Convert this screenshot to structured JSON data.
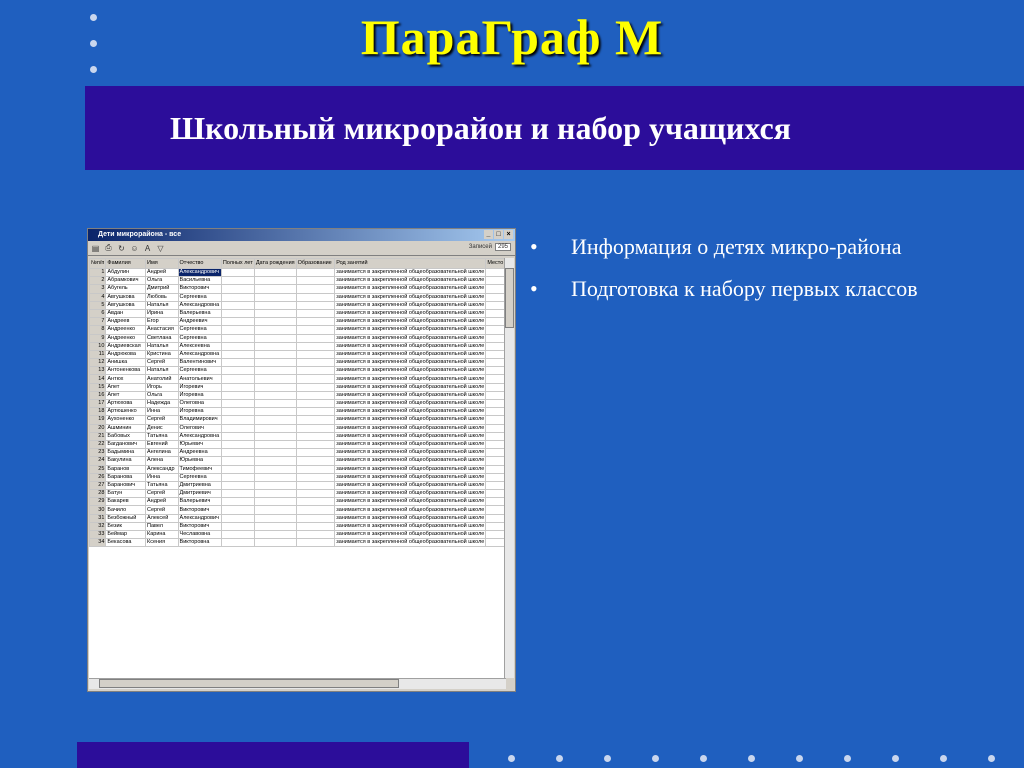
{
  "slide": {
    "title": "ПараГраф М",
    "subtitle": "Школьный микрорайон и набор учащихся",
    "bullets": [
      "Информация о детях микро-района",
      "Подготовка к набору первых классов"
    ]
  },
  "window": {
    "title": "Дети микрорайона - все",
    "controls": [
      "_",
      "□",
      "×"
    ],
    "toolbar_icons": [
      "save-icon",
      "print-icon",
      "refresh-icon",
      "person-icon",
      "text-icon",
      "filter-icon"
    ],
    "toolbar_glyphs": [
      "▤",
      "⎙",
      "↻",
      "☺",
      "A",
      "▽"
    ],
    "status_label": "Записей",
    "status_count": "295",
    "columns": [
      "№п/п",
      "Фамилия",
      "Имя",
      "Отчество",
      "Полных лет",
      "Дата рождения",
      "Образование",
      "Род занятий",
      "Место"
    ],
    "occupation": "занимается в закрепленной общеобразовательной школе",
    "rows": [
      [
        "1",
        "Абдулин",
        "Андрей",
        "Александрович"
      ],
      [
        "2",
        "Абрамкович",
        "Ольга",
        "Васильевна"
      ],
      [
        "3",
        "Абугель",
        "Дмитрий",
        "Викторович"
      ],
      [
        "4",
        "Авгушкова",
        "Любовь",
        "Сергеевна"
      ],
      [
        "5",
        "Авгушкова",
        "Наталья",
        "Александровна"
      ],
      [
        "6",
        "Авдан",
        "Ирина",
        "Валерьевна"
      ],
      [
        "7",
        "Андреев",
        "Егор",
        "Андреевич"
      ],
      [
        "8",
        "Андреенко",
        "Анастасия",
        "Сергеевна"
      ],
      [
        "9",
        "Андреенко",
        "Светлана",
        "Сергеевна"
      ],
      [
        "10",
        "Андриевская",
        "Наталья",
        "Алексеевна"
      ],
      [
        "11",
        "Андрюкова",
        "Кристина",
        "Александровна"
      ],
      [
        "12",
        "Анишка",
        "Сергей",
        "Валентинович"
      ],
      [
        "13",
        "Антоненкова",
        "Наталья",
        "Сергеевна"
      ],
      [
        "14",
        "Антюх",
        "Анатолий",
        "Анатольевич"
      ],
      [
        "15",
        "Апет",
        "Игорь",
        "Игоревич"
      ],
      [
        "16",
        "Апет",
        "Ольга",
        "Игоревна"
      ],
      [
        "17",
        "Артюхова",
        "Надежда",
        "Олеговна"
      ],
      [
        "18",
        "Артюшенко",
        "Инна",
        "Игоревна"
      ],
      [
        "19",
        "Аухоненко",
        "Сергей",
        "Владимирович"
      ],
      [
        "20",
        "Ашминин",
        "Денис",
        "Олегович"
      ],
      [
        "21",
        "Бабовых",
        "Татьяна",
        "Александровна"
      ],
      [
        "22",
        "Багданович",
        "Евгений",
        "Юрьевич"
      ],
      [
        "23",
        "Бадымина",
        "Ангелина",
        "Андреевна"
      ],
      [
        "24",
        "Бакулина",
        "Алена",
        "Юрьевна"
      ],
      [
        "25",
        "Баранов",
        "Александр",
        "Тимофеевич"
      ],
      [
        "26",
        "Баранова",
        "Инна",
        "Сергеевна"
      ],
      [
        "27",
        "Баранович",
        "Татьяна",
        "Дмитриевна"
      ],
      [
        "28",
        "Батун",
        "Сергей",
        "Дмитриевич"
      ],
      [
        "29",
        "Бакарев",
        "Андрей",
        "Валерьевич"
      ],
      [
        "30",
        "Бачило",
        "Сергей",
        "Викторович"
      ],
      [
        "31",
        "Безбожный",
        "Алексей",
        "Александрович"
      ],
      [
        "32",
        "Безик",
        "Павел",
        "Викторович"
      ],
      [
        "33",
        "Беймар",
        "Карина",
        "Чеславовна"
      ],
      [
        "34",
        "Бекасова",
        "Ксения",
        "Викторовна"
      ]
    ]
  }
}
